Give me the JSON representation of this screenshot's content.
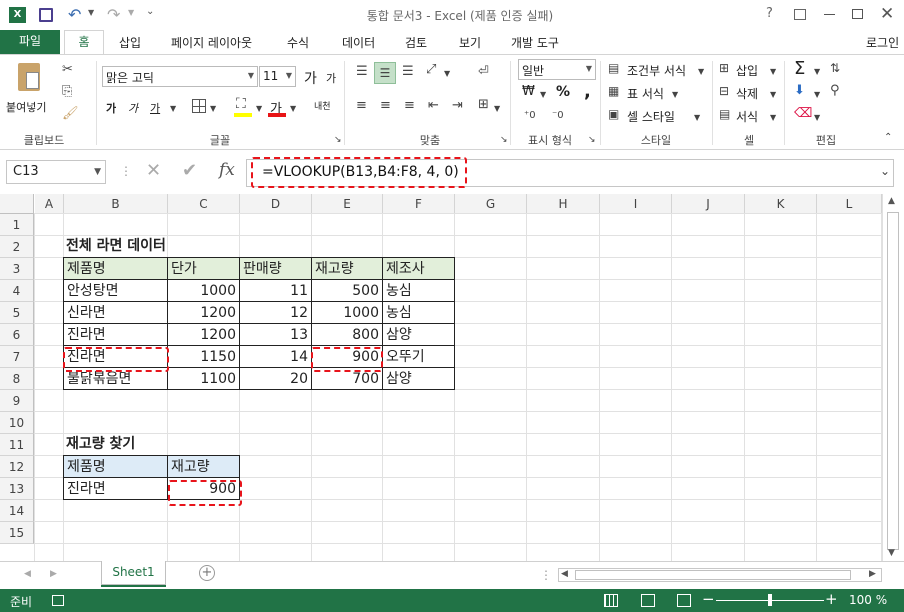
{
  "window": {
    "title": "통합 문서3 - Excel (제품 인증 실패)",
    "help": "?",
    "signin": "로그인"
  },
  "colors": {
    "accent": "#217346",
    "highlight": "#e8141b",
    "header_fill": "#e2efda",
    "lookup_header_fill": "#ddebf7"
  },
  "tabs": [
    "파일",
    "홈",
    "삽입",
    "페이지 레이아웃",
    "수식",
    "데이터",
    "검토",
    "보기",
    "개발 도구"
  ],
  "ribbon": {
    "clipboard": {
      "paste": "붙여넣기",
      "label": "클립보드"
    },
    "font": {
      "name": "맑은 고딕",
      "size": "11",
      "grow": "가",
      "shrink": "가",
      "bold": "가",
      "italic": "가",
      "underline": "가",
      "fill_glyph": "가",
      "phonetic": "내천",
      "label": "글꼴"
    },
    "align": {
      "label": "맞춤"
    },
    "number": {
      "format": "일반",
      "currency": "₩",
      "percent": "%",
      "comma": ",",
      "label": "표시 형식"
    },
    "styles": {
      "cond": "조건부 서식",
      "table": "표 서식",
      "cell": "셀 스타일",
      "label": "스타일"
    },
    "cells": {
      "insert": "삽입",
      "delete": "삭제",
      "format": "서식",
      "label": "셀"
    },
    "editing": {
      "label": "편집",
      "sum": "Σ"
    }
  },
  "formula_bar": {
    "name_box": "C13",
    "formula": "=VLOOKUP(B13,B4:F8, 4, 0)",
    "fx": "fx"
  },
  "columns": [
    "A",
    "B",
    "C",
    "D",
    "E",
    "F",
    "G",
    "H",
    "I",
    "J",
    "K",
    "L"
  ],
  "rows": [
    "1",
    "2",
    "3",
    "4",
    "5",
    "6",
    "7",
    "8",
    "9",
    "10",
    "11",
    "12",
    "13",
    "14",
    "15"
  ],
  "table1": {
    "title": "전체 라면 데이터",
    "headers": [
      "제품명",
      "단가",
      "판매량",
      "재고량",
      "제조사"
    ],
    "rows": [
      [
        "안성탕면",
        "1000",
        "11",
        "500",
        "농심"
      ],
      [
        "신라면",
        "1200",
        "12",
        "1000",
        "농심"
      ],
      [
        "진라면",
        "1200",
        "13",
        "800",
        "삼양"
      ],
      [
        "진라면",
        "1150",
        "14",
        "900",
        "오뚜기"
      ],
      [
        "불닭볶음면",
        "1100",
        "20",
        "700",
        "삼양"
      ]
    ]
  },
  "table2": {
    "title": "재고량 찾기",
    "headers": [
      "제품명",
      "재고량"
    ],
    "row": [
      "진라면",
      "900"
    ]
  },
  "sheet_tabs": [
    "Sheet1"
  ],
  "status": {
    "ready": "준비",
    "zoom": "100 %"
  }
}
